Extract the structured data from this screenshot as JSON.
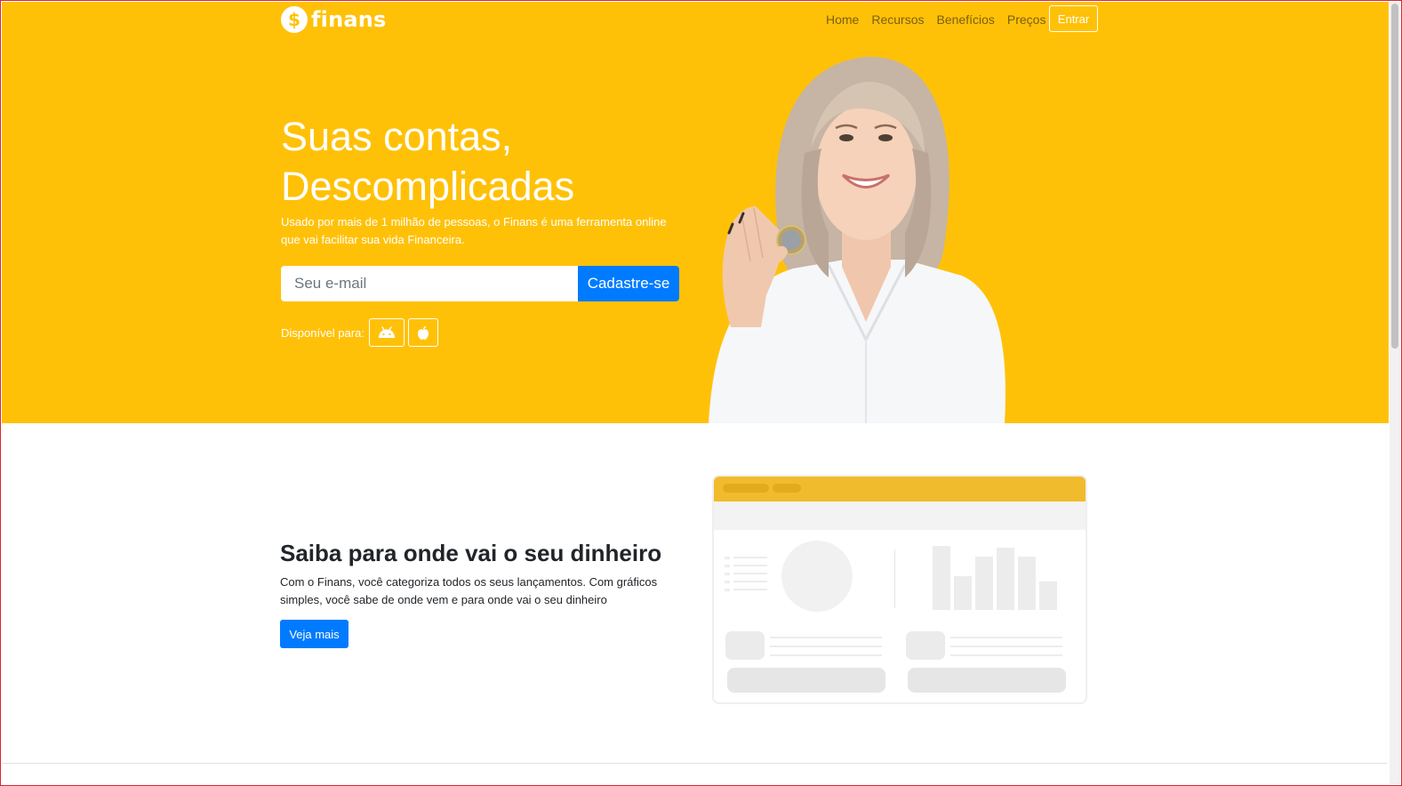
{
  "brand": {
    "icon_symbol": "$",
    "name": "finans"
  },
  "nav": {
    "items": [
      "Home",
      "Recursos",
      "Benefícios",
      "Preços"
    ],
    "login_label": "Entrar"
  },
  "hero": {
    "title_line1": "Suas contas,",
    "title_line2": "Descomplicadas",
    "description": "Usado por mais de 1 milhão de pessoas, o Finans é uma ferramenta online que vai facilitar sua vida Financeira.",
    "email_placeholder": "Seu e-mail",
    "signup_label": "Cadastre-se",
    "available_label": "Disponível para:",
    "platforms": [
      "android-icon",
      "apple-icon"
    ],
    "hero_image": "woman-holding-coin-photo"
  },
  "feature": {
    "title": "Saiba para onde vai o seu dinheiro",
    "description": "Com o Finans, você categoriza todos os seus lançamentos. Com gráficos simples, você sabe de onde vem e para onde vai o seu dinheiro",
    "button_label": "Veja mais",
    "illustration": "dashboard-wireframe"
  },
  "colors": {
    "brand_yellow": "#ffc107",
    "primary_blue": "#007bff",
    "mockup_header": "#f0bb2c"
  }
}
